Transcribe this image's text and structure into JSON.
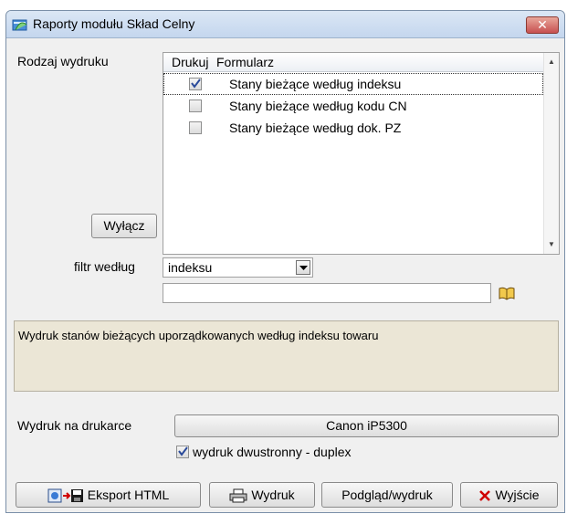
{
  "window": {
    "title": "Raporty modułu Skład Celny",
    "close_label": "✕"
  },
  "rodzaj_wydruku": {
    "label": "Rodzaj wydruku",
    "wylacz_label": "Wyłącz",
    "columns": [
      "Drukuj",
      "Formularz"
    ],
    "rows": [
      {
        "checked": true,
        "label": "Stany bieżące według indeksu"
      },
      {
        "checked": false,
        "label": "Stany bieżące według kodu CN"
      },
      {
        "checked": false,
        "label": "Stany bieżące według dok. PZ"
      }
    ]
  },
  "filter": {
    "label": "filtr według",
    "selected": "indeksu",
    "value": ""
  },
  "description": "Wydruk stanów bieżących uporządkowanych według indeksu towaru",
  "printer": {
    "label": "Wydruk na drukarce",
    "name": "Canon iP5300",
    "duplex_checked": true,
    "duplex_label": "wydruk dwustronny - duplex"
  },
  "buttons": {
    "export_html": "Eksport HTML",
    "print": "Wydruk",
    "preview": "Podgląd/wydruk",
    "exit": "Wyjście"
  },
  "icons": {
    "app": "app-window-icon",
    "book": "open-book-icon",
    "export": "export-save-icon",
    "printer": "printer-icon",
    "exit": "red-x-icon"
  }
}
